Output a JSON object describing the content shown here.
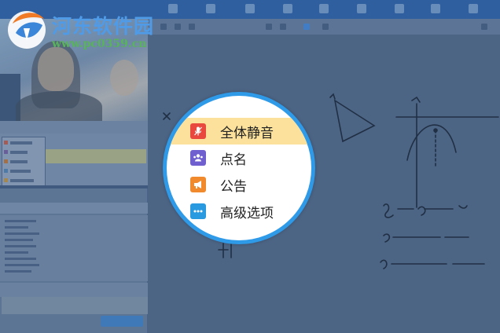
{
  "watermark": {
    "site_name": "河东软件园",
    "site_url": "www.pc0359.cn"
  },
  "popup_menu": {
    "items": [
      {
        "label": "全体静音",
        "icon": "mute-mic-icon",
        "icon_color": "#e9483f",
        "active": true
      },
      {
        "label": "点名",
        "icon": "roll-call-people-icon",
        "icon_color": "#6f5fcf",
        "active": false
      },
      {
        "label": "公告",
        "icon": "announcement-megaphone-icon",
        "icon_color": "#f08a2c",
        "active": false
      },
      {
        "label": "高级选项",
        "icon": "more-options-icon",
        "icon_color": "#2a9ae0",
        "active": false
      }
    ]
  },
  "colors": {
    "magnifier_border": "#2f9ae8",
    "active_row": "#fbe19b",
    "logo_blue": "#4f9be8",
    "logo_green": "#58b35a"
  }
}
